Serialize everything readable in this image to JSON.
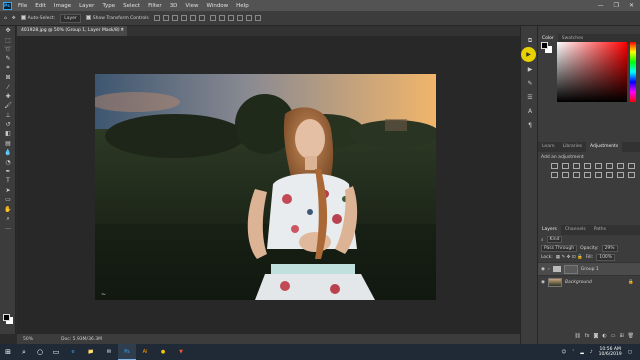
{
  "menubar": {
    "logo": "Ps",
    "items": [
      "File",
      "Edit",
      "Image",
      "Layer",
      "Type",
      "Select",
      "Filter",
      "3D",
      "View",
      "Window",
      "Help"
    ],
    "window_controls": [
      "—",
      "❐",
      "✕"
    ]
  },
  "options_bar": {
    "auto_select_label": "Auto-Select:",
    "auto_select_value": "Layer",
    "show_transform_label": "Show Transform Controls"
  },
  "document": {
    "tab_title": "401928.jpg @ 50% (Group 1, Layer Mask/8) *",
    "tab_close": "×"
  },
  "status": {
    "zoom": "50%",
    "doc_size": "Doc: 5.93M/36.3M"
  },
  "color_panel": {
    "tabs": [
      "Color",
      "Swatches"
    ],
    "accent": "#ff0000"
  },
  "adjustments_panel": {
    "tabs": [
      "Learn",
      "Libraries",
      "Adjustments"
    ],
    "add_label": "Add an adjustment"
  },
  "layers_panel": {
    "tabs": [
      "Layers",
      "Channels",
      "Paths"
    ],
    "kind_filter": "Kind",
    "blend_mode": "Pass Through",
    "opacity_label": "Opacity:",
    "opacity_value": "29%",
    "lock_label": "Lock:",
    "fill_label": "Fill:",
    "fill_value": "100%",
    "layers": [
      {
        "name": "Group 1"
      },
      {
        "name": "Background"
      }
    ]
  },
  "taskbar": {
    "time": "10:56 AM",
    "date": "10/6/2019",
    "apps": [
      "e",
      "📁",
      "✉",
      "Ps",
      "Ai",
      "●",
      "▼"
    ]
  }
}
